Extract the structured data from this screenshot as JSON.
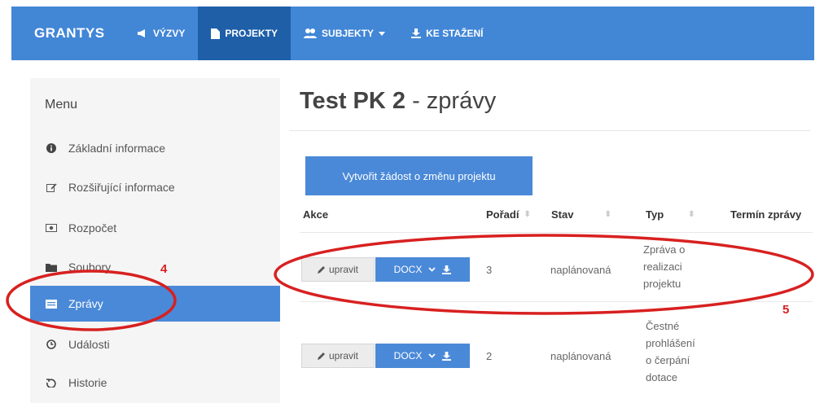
{
  "navbar": {
    "brand": "GRANTYS",
    "items": [
      {
        "label": "VÝZVY",
        "icon": "megaphone-icon"
      },
      {
        "label": "PROJEKTY",
        "icon": "file-icon",
        "active": true
      },
      {
        "label": "SUBJEKTY",
        "icon": "users-icon",
        "dropdown": true
      },
      {
        "label": "KE STAŽENÍ",
        "icon": "download-icon"
      }
    ]
  },
  "sidebar": {
    "title": "Menu",
    "items": [
      {
        "label": "Základní informace",
        "icon": "info-icon"
      },
      {
        "label": "Rozšiřující informace",
        "icon": "edit-icon"
      },
      {
        "label": "Rozpočet",
        "icon": "money-icon"
      },
      {
        "label": "Soubory",
        "icon": "folder-icon"
      },
      {
        "label": "Zprávy",
        "icon": "report-icon",
        "active": true
      },
      {
        "label": "Události",
        "icon": "clock-icon"
      },
      {
        "label": "Historie",
        "icon": "history-icon"
      }
    ]
  },
  "main": {
    "title_bold": "Test PK 2",
    "title_rest": " - zprávy",
    "create_button": "Vytvořit žádost o změnu projektu",
    "columns": [
      "Akce",
      "Pořadí",
      "Stav",
      "Typ",
      "Termín zprávy"
    ],
    "rows": [
      {
        "edit": "upravit",
        "docx": "DOCX",
        "order": "3",
        "status": "naplánovaná",
        "type": [
          "Zpráva o",
          "realizaci",
          "projektu"
        ]
      },
      {
        "edit": "upravit",
        "docx": "DOCX",
        "order": "2",
        "status": "naplánovaná",
        "type": [
          "Čestné",
          "prohlášení",
          "o čerpání",
          "dotace"
        ]
      }
    ]
  },
  "annotations": {
    "a4": "4",
    "a5": "5"
  },
  "colors": {
    "primary": "#4286d6",
    "active_nav": "#1e5fa8",
    "annotation": "#d82020"
  }
}
